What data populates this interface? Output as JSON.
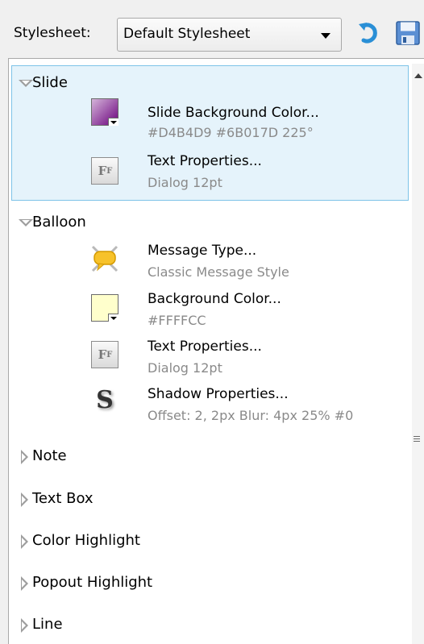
{
  "toolbar": {
    "label": "Stylesheet:",
    "combo_value": "Default Stylesheet",
    "icons": [
      "undo-icon",
      "save-icon"
    ]
  },
  "sections": {
    "slide": {
      "title": "Slide",
      "expanded": true,
      "selected": true,
      "props": [
        {
          "title": "Slide Background Color...",
          "value": "#D4B4D9 #6B017D 225°",
          "icon": "gradient-swatch-icon"
        },
        {
          "title": "Text Properties...",
          "value": "Dialog 12pt",
          "icon": "font-icon"
        }
      ]
    },
    "balloon": {
      "title": "Balloon",
      "expanded": true,
      "props": [
        {
          "title": "Message Type...",
          "value": "Classic Message Style",
          "icon": "balloon-message-icon"
        },
        {
          "title": "Background Color...",
          "value": "#FFFFCC",
          "icon": "color-swatch-icon"
        },
        {
          "title": "Text Properties...",
          "value": "Dialog 12pt",
          "icon": "font-icon"
        },
        {
          "title": "Shadow Properties...",
          "value": "Offset: 2, 2px Blur: 4px 25% #0",
          "icon": "shadow-icon"
        }
      ]
    },
    "collapsed": [
      {
        "title": "Note"
      },
      {
        "title": "Text Box"
      },
      {
        "title": "Color Highlight"
      },
      {
        "title": "Popout Highlight"
      },
      {
        "title": "Line"
      }
    ]
  },
  "colors": {
    "selection_bg": "#e5f3fb",
    "selection_border": "#7ec3e8",
    "slide_gradient_start": "#D4B4D9",
    "slide_gradient_end": "#6B017D",
    "balloon_bg": "#FFFFCC"
  }
}
